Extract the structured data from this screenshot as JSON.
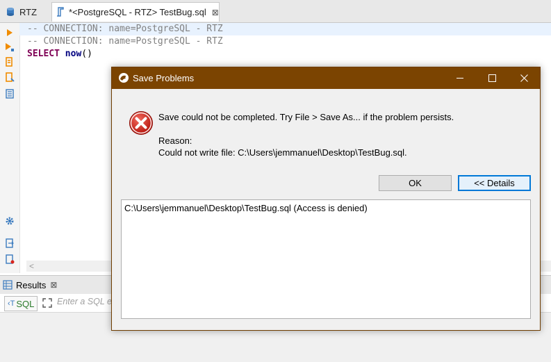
{
  "tabs": [
    {
      "label": "RTZ",
      "icon": "database-icon"
    },
    {
      "label": "*<PostgreSQL - RTZ> TestBug.sql",
      "icon": "sql-file-icon",
      "close": "⊠"
    }
  ],
  "editor": {
    "lines": [
      {
        "text": "-- CONNECTION: name=PostgreSQL - RTZ"
      },
      {
        "text": "-- CONNECTION: name=PostgreSQL - RTZ"
      },
      {
        "keyword": "SELECT",
        "function": "now",
        "rest": "()"
      }
    ],
    "scroll_arrow": "<"
  },
  "gutter_icons": [
    "execute-statement-icon",
    "execute-script-icon",
    "explain-plan-icon",
    "load-plan-icon",
    "script-icon",
    "settings-icon",
    "export-icon",
    "export-log-icon"
  ],
  "results": {
    "tab_label": "Results",
    "tab_close": "⊠",
    "sql_button": "SQL",
    "filter_placeholder": "Enter a SQL expression to filter results"
  },
  "dialog": {
    "title": "Save Problems",
    "message": "Save could not be completed. Try File > Save As... if the problem persists.",
    "reason_label": "Reason:",
    "reason_text": "Could not write file: C:\\Users\\jemmanuel\\Desktop\\TestBug.sql.",
    "ok_label": "OK",
    "details_label": "<< Details",
    "details_text": "C:\\Users\\jemmanuel\\Desktop\\TestBug.sql (Access is denied)"
  },
  "colors": {
    "titlebar": "#7b4401",
    "accent": "#0078d7",
    "error_red": "#d9251d"
  }
}
